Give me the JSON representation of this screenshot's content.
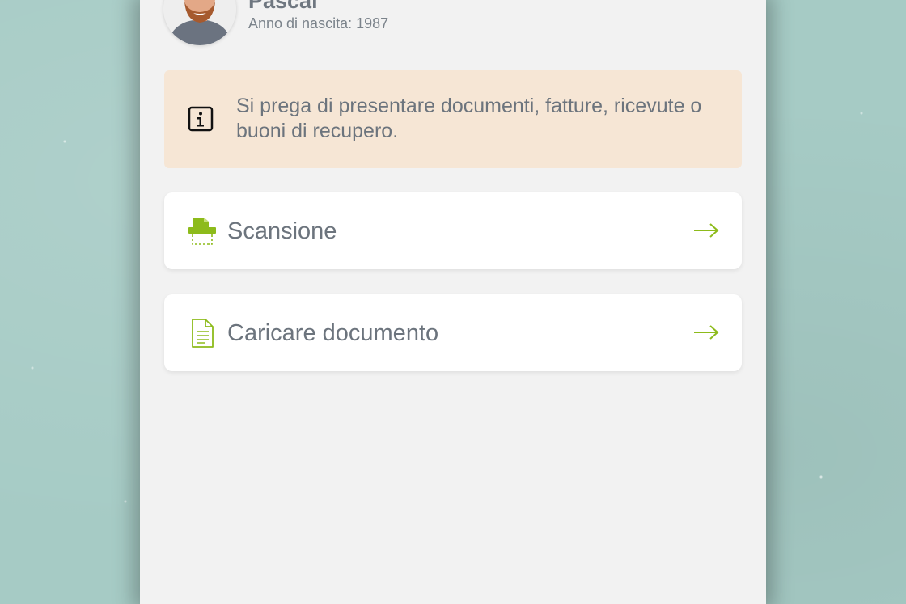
{
  "profile": {
    "name": "Pascal",
    "birth_label": "Anno di nascita: 1987"
  },
  "info": {
    "icon": "info-icon",
    "message": "Si prega di presentare documenti, fatture, ricevute o buoni di recupero."
  },
  "actions": [
    {
      "label": "Scansione",
      "icon": "scanner-icon",
      "arrow": "arrow-right-icon"
    },
    {
      "label": "Caricare documento",
      "icon": "document-icon",
      "arrow": "arrow-right-icon"
    }
  ],
  "colors": {
    "accent": "#8dbb1b",
    "info_background": "#f6e6d5",
    "page_background": "#a6cbc5",
    "panel_background": "#f2f2f2",
    "text": "#6c747d"
  }
}
